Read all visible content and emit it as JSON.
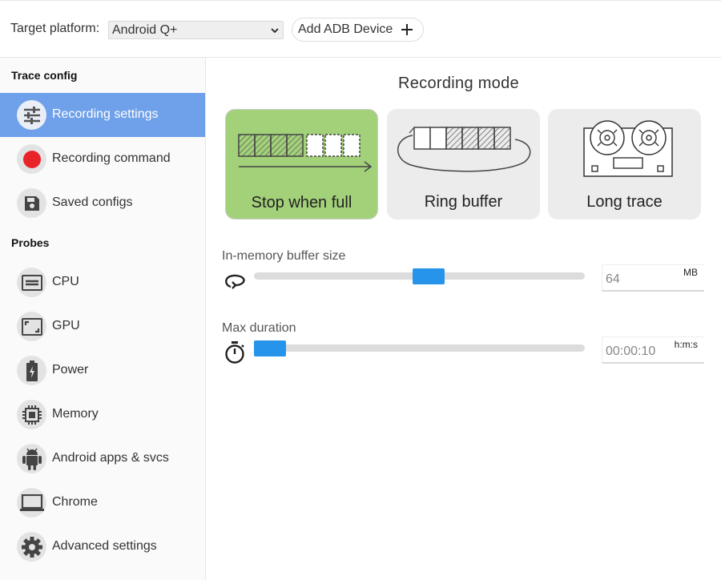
{
  "header": {
    "target_platform_label": "Target platform:",
    "target_platform_value": "Android Q+",
    "add_adb_label": "Add ADB Device"
  },
  "sidebar": {
    "trace_config_title": "Trace config",
    "trace_items": [
      {
        "label": "Recording settings",
        "icon": "sliders-icon",
        "active": true
      },
      {
        "label": "Recording command",
        "icon": "record-icon"
      },
      {
        "label": "Saved configs",
        "icon": "save-icon"
      }
    ],
    "probes_title": "Probes",
    "probe_items": [
      {
        "label": "CPU",
        "icon": "cpu-icon"
      },
      {
        "label": "GPU",
        "icon": "gpu-icon"
      },
      {
        "label": "Power",
        "icon": "battery-icon"
      },
      {
        "label": "Memory",
        "icon": "memory-chip-icon"
      },
      {
        "label": "Android apps & svcs",
        "icon": "android-icon"
      },
      {
        "label": "Chrome",
        "icon": "laptop-icon"
      },
      {
        "label": "Advanced settings",
        "icon": "gear-icon"
      }
    ]
  },
  "main": {
    "title": "Recording mode",
    "modes": [
      {
        "label": "Stop when full",
        "selected": true
      },
      {
        "label": "Ring buffer",
        "selected": false
      },
      {
        "label": "Long trace",
        "selected": false
      }
    ],
    "buffer": {
      "label": "In-memory buffer size",
      "value": "64",
      "unit": "MB",
      "slider_fraction": 0.53
    },
    "duration": {
      "label": "Max duration",
      "value": "00:00:10",
      "unit": "h:m:s",
      "slider_fraction": 0.0
    }
  },
  "colors": {
    "active_nav": "#6fa0ea",
    "selected_mode": "#a3d17a",
    "slider_thumb": "#2594ea",
    "record_dot": "#e8242a"
  }
}
